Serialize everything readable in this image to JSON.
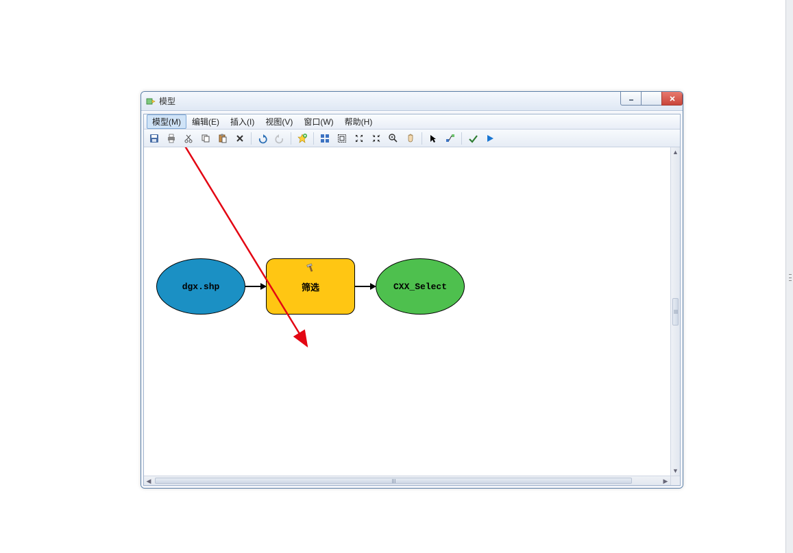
{
  "window": {
    "title": "模型"
  },
  "menubar": {
    "items": [
      {
        "label": "模型(M)",
        "name": "menu-model",
        "active": true
      },
      {
        "label": "编辑(E)",
        "name": "menu-edit"
      },
      {
        "label": "插入(I)",
        "name": "menu-insert"
      },
      {
        "label": "视图(V)",
        "name": "menu-view"
      },
      {
        "label": "窗口(W)",
        "name": "menu-window"
      },
      {
        "label": "帮助(H)",
        "name": "menu-help"
      }
    ]
  },
  "toolbar": {
    "buttons": [
      "save-icon",
      "print-icon",
      "cut-icon",
      "copy-icon",
      "paste-icon",
      "delete-icon",
      "sep",
      "undo-icon",
      "redo-icon",
      "sep",
      "add-data-icon",
      "sep",
      "auto-layout-icon",
      "full-extent-icon",
      "zoom-in-fixed-icon",
      "zoom-out-fixed-icon",
      "zoom-in-icon",
      "pan-icon",
      "sep",
      "select-icon",
      "connect-icon",
      "sep",
      "validate-icon",
      "run-icon"
    ]
  },
  "diagram": {
    "input": {
      "label": "dgx.shp"
    },
    "tool": {
      "label": "筛选"
    },
    "output": {
      "label": "CXX_Select"
    }
  }
}
